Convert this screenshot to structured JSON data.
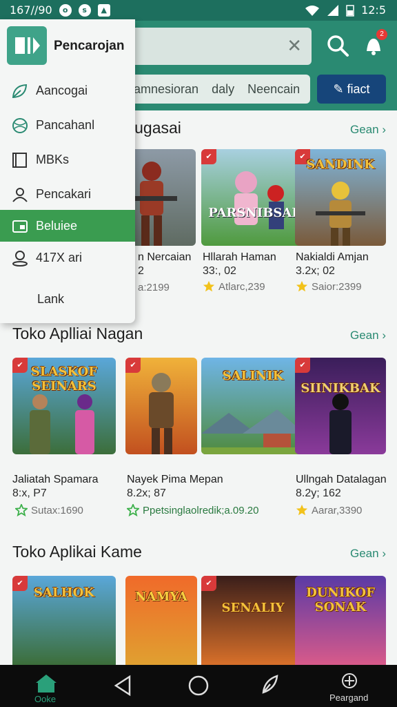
{
  "status_bar": {
    "time_left": "167//90",
    "time_right": "12:5"
  },
  "search": {
    "placeholder": ""
  },
  "notification_count": "2",
  "filters": [
    "amnesioran",
    "daly",
    "Neencain"
  ],
  "fact_button": "fiact",
  "drawer": {
    "title": "Pencarojan",
    "items": [
      {
        "label": "Aancogai",
        "icon": "leaf-icon"
      },
      {
        "label": "Pancahanl",
        "icon": "globe-icon"
      },
      {
        "label": "MBKs",
        "icon": "book-icon"
      },
      {
        "label": "Pencakari",
        "icon": "person-icon"
      },
      {
        "label": "Beluiee",
        "icon": "card-icon",
        "active": true
      },
      {
        "label": "417X ari",
        "icon": "user-icon"
      },
      {
        "label": "Lank",
        "icon": ""
      }
    ]
  },
  "sections": [
    {
      "title": "lugasai",
      "see_more": "Gean",
      "apps": [
        {
          "name": "",
          "sub": "",
          "rating": "",
          "logo": ""
        },
        {
          "name": "n Nercaian",
          "sub": "2",
          "rating": "a:2199",
          "logo": ""
        },
        {
          "name": "Hllarah Haman",
          "sub": "33:, 02",
          "rating": "Atlarc,239",
          "logo": "PARSNIBSAI"
        },
        {
          "name": "Nakialdi Amjan",
          "sub": "3.2x; 02",
          "rating": "Saior:2399",
          "logo": "SANDINK"
        }
      ]
    },
    {
      "title": "Toko Aplliai Nagan",
      "see_more": "Gean",
      "apps": [
        {
          "name": "Jaliatah Spamara",
          "sub": "8:x, P7",
          "rating": "Sutax:1690",
          "logo": "SLASKOF SEINARS"
        },
        {
          "name": "Nayek Pima Mepan",
          "sub": "8.2x; 87",
          "rating": "Ppetsinglaolredik;a.09.20",
          "logo": ""
        },
        {
          "name": "",
          "sub": "",
          "rating": "",
          "logo": "SALINIK"
        },
        {
          "name": "Ullngah Datalagan",
          "sub": "8.2y; 162",
          "rating": "Aarar,3390",
          "logo": "SIINIKBAK"
        }
      ]
    },
    {
      "title": "Toko Aplikai Kame",
      "see_more": "Gean",
      "apps": [
        {
          "logo": "SALHOK"
        },
        {
          "logo": "NAMYA"
        },
        {
          "logo": "SENALIY"
        },
        {
          "logo": "DUNIKOF SONAK"
        }
      ]
    }
  ],
  "bottom_nav": {
    "home_label": "Ooke",
    "right_label": "Peargand"
  },
  "colors": {
    "primary": "#2a8a72",
    "accent": "#16457a",
    "active_item": "#3a9c50"
  }
}
